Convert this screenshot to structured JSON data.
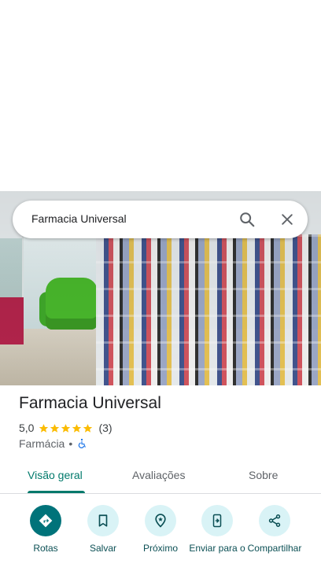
{
  "search": {
    "query": "Farmacia Universal"
  },
  "place": {
    "name": "Farmacia Universal",
    "rating_value": "5,0",
    "rating_stars": 5,
    "review_count": "(3)",
    "category": "Farmácia",
    "separator": "•"
  },
  "tabs": [
    {
      "label": "Visão geral",
      "active": true
    },
    {
      "label": "Avaliações",
      "active": false
    },
    {
      "label": "Sobre",
      "active": false
    }
  ],
  "actions": [
    {
      "label": "Rotas",
      "icon": "directions-icon"
    },
    {
      "label": "Salvar",
      "icon": "bookmark-icon"
    },
    {
      "label": "Próximo",
      "icon": "nearby-icon"
    },
    {
      "label": "Enviar para o",
      "icon": "send-to-phone-icon"
    },
    {
      "label": "Compartilhar",
      "icon": "share-icon"
    }
  ],
  "colors": {
    "accent": "#00796b",
    "action_bg": "#d9f3f6",
    "primary_action_bg": "#00737a",
    "star": "#fbbc04"
  }
}
